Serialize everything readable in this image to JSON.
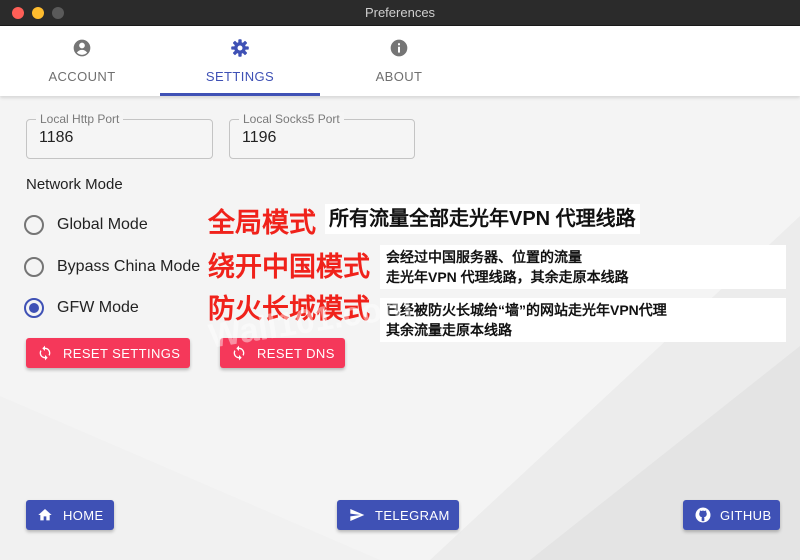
{
  "window": {
    "title": "Preferences"
  },
  "tabs": [
    {
      "label": "ACCOUNT",
      "icon": "account-circle-icon",
      "active": false
    },
    {
      "label": "SETTINGS",
      "icon": "gear-icon",
      "active": true
    },
    {
      "label": "ABOUT",
      "icon": "info-icon",
      "active": false
    }
  ],
  "ports": {
    "http": {
      "label": "Local Http Port",
      "value": "1186"
    },
    "socks5": {
      "label": "Local Socks5 Port",
      "value": "1196"
    }
  },
  "network": {
    "title": "Network Mode",
    "selected": "GFW Mode",
    "modes": [
      {
        "label": "Global Mode",
        "checked": false
      },
      {
        "label": "Bypass China Mode",
        "checked": false
      },
      {
        "label": "GFW Mode",
        "checked": true
      }
    ]
  },
  "annotations": {
    "global": {
      "title": "全局模式",
      "lines": [
        "所有流量全部走光年VPN 代理线路"
      ]
    },
    "bypass": {
      "title": "绕开中国模式",
      "lines": [
        "会经过中国服务器、位置的流量",
        "走光年VPN 代理线路，其余走原本线路"
      ]
    },
    "gfw": {
      "title": "防火长城模式",
      "lines": [
        "已经被防火长城给“墙”的网站走光年VPN代理",
        "其余流量走原本线路"
      ]
    },
    "watermark": "Wall101.com"
  },
  "actions": {
    "reset_settings": "RESET SETTINGS",
    "reset_dns": "RESET DNS"
  },
  "footer": {
    "home": "HOME",
    "telegram": "TELEGRAM",
    "github": "GITHUB"
  },
  "colors": {
    "primary": "#3f51b5",
    "danger": "#f5385a",
    "annotation": "#f0221b"
  }
}
